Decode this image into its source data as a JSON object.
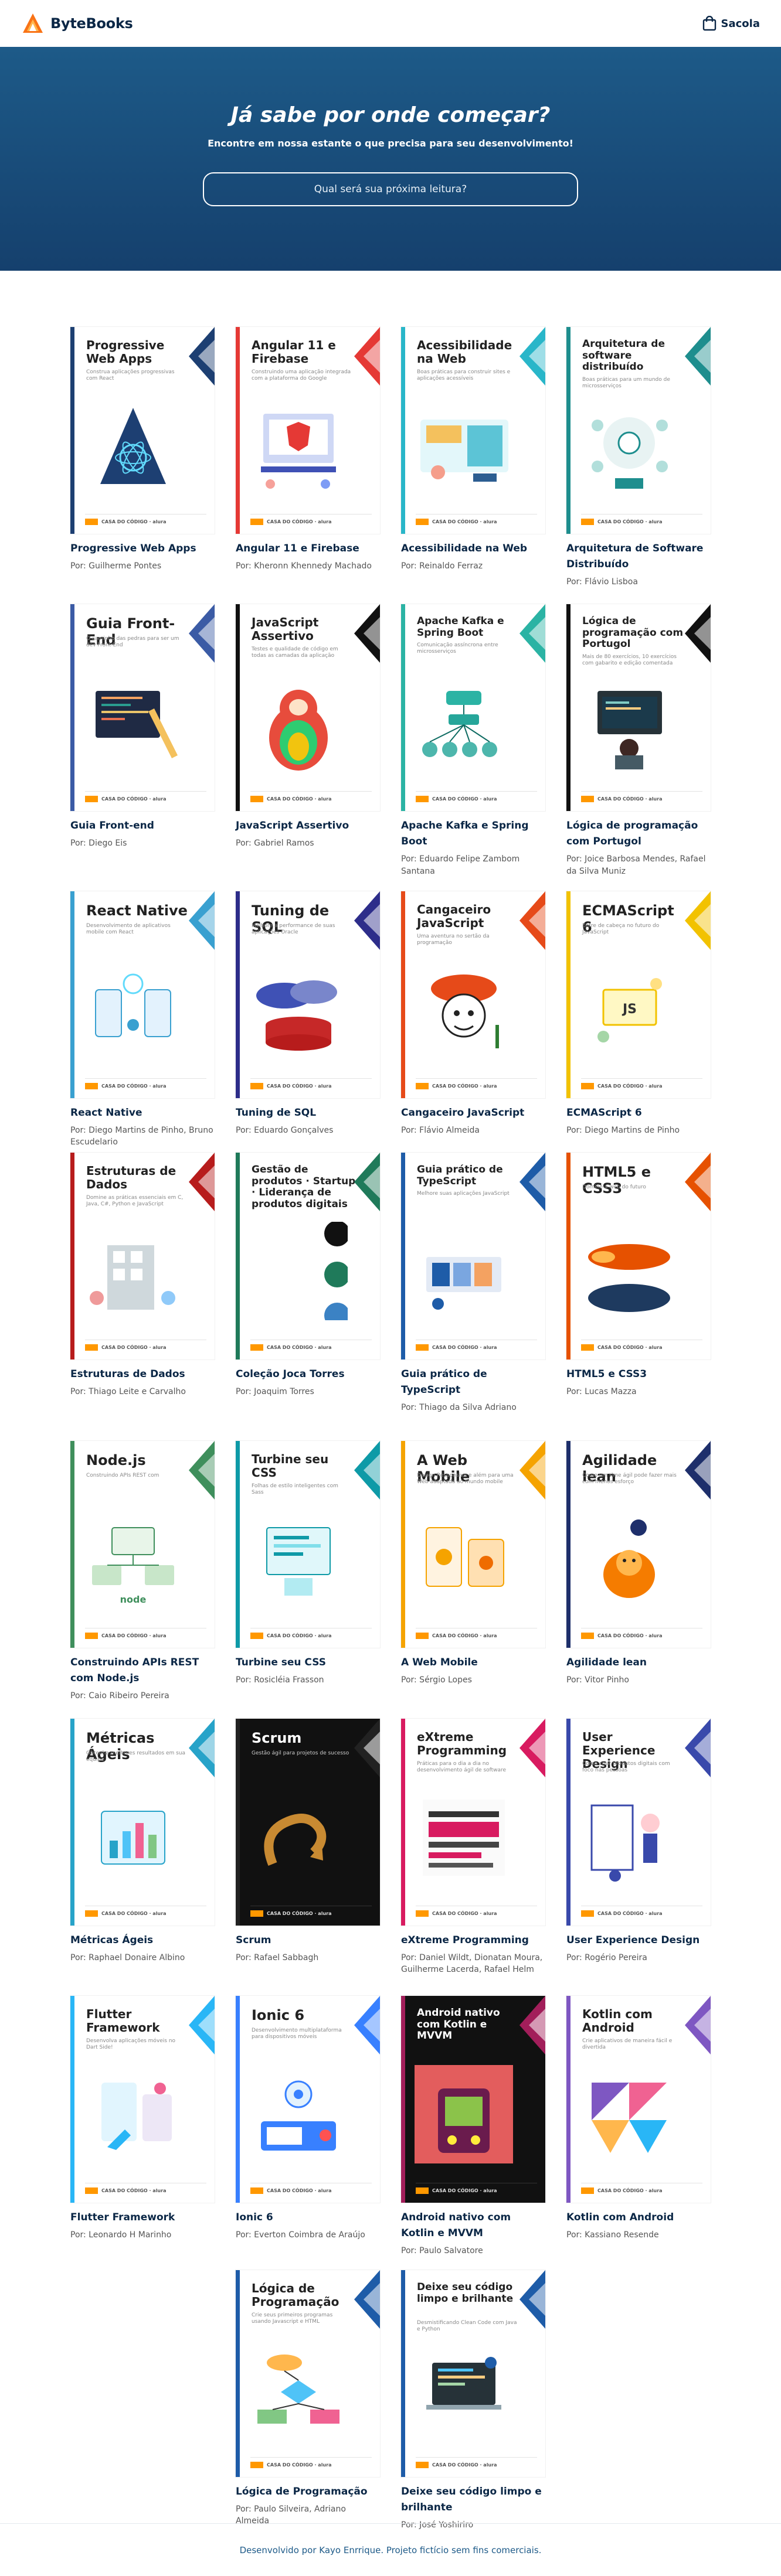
{
  "brand": {
    "name": "ByteBooks",
    "accent": "#ff9800",
    "mark_accent": "#f97316",
    "icon": "bytebooks-logo-icon"
  },
  "header": {
    "bag_label": "Sacola",
    "bag_icon": "shopping-bag-icon"
  },
  "hero": {
    "title": "Já sabe por onde começar?",
    "subtitle": "Encontre em nossa estante o que precisa para seu desenvolvimento!",
    "search_placeholder": "Qual será sua próxima leitura?",
    "background": "#1d5a88"
  },
  "books": [
    {
      "title": "Progressive Web Apps",
      "author": "Por: Guilherme Pontes",
      "cover_title": "Progressive Web Apps",
      "cover_sub": "Construa aplicações progressivas com React",
      "color": "#1d3f72",
      "art": "pwa"
    },
    {
      "title": "Angular 11 e Firebase",
      "author": "Por: Kheronn Khennedy Machado",
      "cover_title": "Angular 11 e Firebase",
      "cover_sub": "Construindo uma aplicação integrada com a plataforma do Google",
      "color": "#e53935",
      "art": "angular"
    },
    {
      "title": "Acessibilidade na Web",
      "author": "Por: Reinaldo Ferraz",
      "cover_title": "Acessibilidade na Web",
      "cover_sub": "Boas práticas para construir sites e aplicações acessíveis",
      "color": "#29b6c9",
      "art": "a11y"
    },
    {
      "title": "Arquitetura de Software Distribuído",
      "author": "Por: Flávio Lisboa",
      "cover_title": "Arquitetura de software distribuído",
      "cover_sub": "Boas práticas para um mundo de microsserviços",
      "color": "#1e8e8e",
      "art": "arch"
    },
    {
      "title": "Guia Front-end",
      "author": "Por: Diego Eis",
      "cover_title": "Guia Front-End",
      "cover_sub": "O caminho das pedras para ser um dev Front-End",
      "color": "#3b5ba5",
      "art": "front"
    },
    {
      "title": "JavaScript Assertivo",
      "author": "Por: Gabriel Ramos",
      "cover_title": "JavaScript Assertivo",
      "cover_sub": "Testes e qualidade de código em todas as camadas da aplicação",
      "color": "#111111",
      "art": "js"
    },
    {
      "title": "Apache Kafka e Spring Boot",
      "author": "Por: Eduardo Felipe Zambom Santana",
      "cover_title": "Apache Kafka e Spring Boot",
      "cover_sub": "Comunicação assíncrona entre microsserviços",
      "color": "#2bb3a4",
      "art": "kafka"
    },
    {
      "title": "Lógica de programação com Portugol",
      "author": "Por: Joice Barbosa Mendes, Rafael da Silva Muniz",
      "cover_title": "Lógica de programação com Portugol",
      "cover_sub": "Mais de 80 exercícios, 10 exercícios com gabarito e edição comentada",
      "color": "#111111",
      "art": "portugol"
    },
    {
      "title": "React Native",
      "author": "Por: Diego Martins de Pinho, Bruno Escudelario",
      "cover_title": "React Native",
      "cover_sub": "Desenvolvimento de aplicativos mobile com React",
      "color": "#39a0d0",
      "art": "rn"
    },
    {
      "title": "Tuning de SQL",
      "author": "Por: Eduardo Gonçalves",
      "cover_title": "Tuning de SQL",
      "cover_sub": "Melhore a performance de suas aplicações Oracle",
      "color": "#2d2d8a",
      "art": "sql"
    },
    {
      "title": "Cangaceiro JavaScript",
      "author": "Por: Flávio Almeida",
      "cover_title": "Cangaceiro JavaScript",
      "cover_sub": "Uma aventura no sertão da programação",
      "color": "#e64a19",
      "art": "cangaceiro"
    },
    {
      "title": "ECMAScript 6",
      "author": "Por: Diego Martins de Pinho",
      "cover_title": "ECMAScript 6",
      "cover_sub": "Entre de cabeça no futuro do JavaScript",
      "color": "#f2c200",
      "art": "es6"
    },
    {
      "title": "Estruturas de Dados",
      "author": "Por: Thiago Leite e Carvalho",
      "cover_title": "Estruturas de Dados",
      "cover_sub": "Domine as práticas essenciais em C, Java, C#, Python e JavaScript",
      "color": "#b71c1c",
      "art": "ed"
    },
    {
      "title": "Coleção Joca Torres",
      "author": "Por: Joaquim Torres",
      "cover_title": "Gestão de produtos · Startup · Liderança de produtos digitais",
      "cover_sub": "",
      "color": "#1f7a5a",
      "art": "joca"
    },
    {
      "title": "Guia prático de TypeScript",
      "author": "Por: Thiago da Silva Adriano",
      "cover_title": "Guia prático de TypeScript",
      "cover_sub": "Melhore suas aplicações JavaScript",
      "color": "#1e5ca8",
      "art": "ts"
    },
    {
      "title": "HTML5 e CSS3",
      "author": "Por: Lucas Mazza",
      "cover_title": "HTML5 e CSS3",
      "cover_sub": "Domine a web do futuro",
      "color": "#e65100",
      "art": "html"
    },
    {
      "title": "Construindo APIs REST com Node.js",
      "author": "Por: Caio Ribeiro Pereira",
      "cover_title": "Node.js",
      "cover_sub": "Construindo APIs REST com",
      "color": "#3f8f5c",
      "art": "node"
    },
    {
      "title": "Turbine seu CSS",
      "author": "Por: Rosicléia Frasson",
      "cover_title": "Turbine seu CSS",
      "cover_sub": "Folhas de estilo inteligentes com Sass",
      "color": "#0e9aa7",
      "art": "css"
    },
    {
      "title": "A Web Mobile",
      "author": "Por: Sérgio Lopes",
      "cover_title": "A Web Mobile",
      "cover_sub": "Design Responsivo e além para uma Web adaptada ao mundo mobile",
      "color": "#f5a300",
      "art": "mobile"
    },
    {
      "title": "Agilidade lean",
      "author": "Por: Vitor Pinho",
      "cover_title": "Agilidade lean",
      "cover_sub": "Como um time ágil pode fazer mais com menos esforço",
      "color": "#1e2f6b",
      "art": "lean"
    },
    {
      "title": "Métricas Ágeis",
      "author": "Por: Raphael Donaire Albino",
      "cover_title": "Métricas Ágeis",
      "cover_sub": "Obtenha melhores resultados em sua equipe",
      "color": "#27a3c9",
      "art": "metricas"
    },
    {
      "title": "Scrum",
      "author": "Por: Rafael Sabbagh",
      "cover_title": "Scrum",
      "cover_sub": "Gestão ágil para projetos de sucesso",
      "color": "#222222",
      "art": "scrum"
    },
    {
      "title": "eXtreme Programming",
      "author": "Por: Daniel Wildt, Dionatan Moura, Guilherme Lacerda, Rafael Helm",
      "cover_title": "eXtreme Programming",
      "cover_sub": "Práticas para o dia a dia no desenvolvimento ágil de software",
      "color": "#d81b60",
      "art": "xp"
    },
    {
      "title": "User Experience Design",
      "author": "Por: Rogério Pereira",
      "cover_title": "User Experience Design",
      "cover_sub": "Como criar produtos digitais com foco nas pessoas",
      "color": "#3949ab",
      "art": "ux"
    },
    {
      "title": "Flutter Framework",
      "author": "Por: Leonardo H Marinho",
      "cover_title": "Flutter Framework",
      "cover_sub": "Desenvolva aplicações móveis no Dart Side!",
      "color": "#29b6f6",
      "art": "flutter"
    },
    {
      "title": "Ionic 6",
      "author": "Por: Everton Coimbra de Araújo",
      "cover_title": "Ionic 6",
      "cover_sub": "Desenvolvimento multiplataforma para dispositivos móveis",
      "color": "#3880ff",
      "art": "ionic"
    },
    {
      "title": "Android nativo com Kotlin e MVVM",
      "author": "Por: Paulo Salvatore",
      "cover_title": "Android nativo com Kotlin e MVVM",
      "cover_sub": "",
      "color": "#a21e5a",
      "art": "android"
    },
    {
      "title": "Kotlin com Android",
      "author": "Por: Kassiano Resende",
      "cover_title": "Kotlin com Android",
      "cover_sub": "Crie aplicativos de maneira fácil e divertida",
      "color": "#7e57c2",
      "art": "kotlin"
    },
    {
      "title": "Lógica de Programação",
      "author": "Por: Paulo Silveira, Adriano Almeida",
      "cover_title": "Lógica de Programação",
      "cover_sub": "Crie seus primeiros programas usando Javascript e HTML",
      "color": "#1e5ca8",
      "art": "logica"
    },
    {
      "title": "Deixe seu código limpo e brilhante",
      "author": "Por: José Yoshiriro",
      "cover_title": "Deixe seu código limpo e brilhante",
      "cover_sub": "Desmistificando Clean Code com Java e Python",
      "color": "#1e5ca8",
      "art": "clean"
    }
  ],
  "cover_footer_label": "CASA DO CÓDIGO · alura",
  "footer": {
    "text": "Desenvolvido por Kayo Enrrique. Projeto fictício sem fins comerciais."
  }
}
